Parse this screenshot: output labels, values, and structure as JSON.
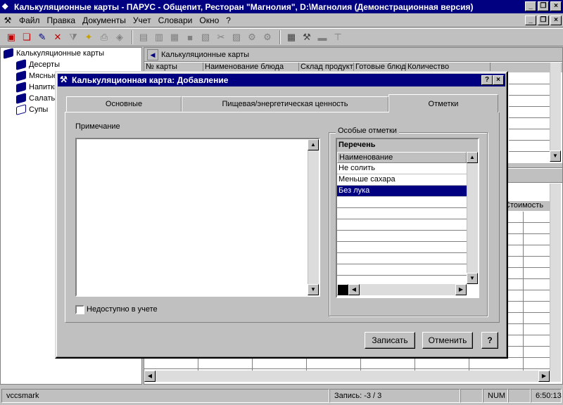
{
  "app": {
    "title": "Калькуляционные карты - ПАРУС - Общепит, Ресторан \"Магнолия\", D:\\Магнолия (Демонстрационная версия)"
  },
  "menu": [
    "Файл",
    "Правка",
    "Документы",
    "Учет",
    "Словари",
    "Окно",
    "?"
  ],
  "tree": {
    "root": "Калькуляционные карты",
    "items": [
      "Десерты",
      "Мясные",
      "Напитки",
      "Салаты",
      "Супы"
    ]
  },
  "rightpane": {
    "header": "Калькуляционные карты",
    "columns": [
      "№ карты",
      "Наименование блюда",
      "Склад продукт",
      "Готовые блюд",
      "Количество"
    ],
    "lower_column": "Стоимость"
  },
  "dialog": {
    "title": "Калькуляционная карта: Добавление",
    "tabs": [
      "Основные",
      "Пищевая/энергетическая ценность",
      "Отметки"
    ],
    "note_label": "Примечание",
    "checkbox_label": "Недоступно в учете",
    "group_title": "Особые отметки",
    "list_title": "Перечень",
    "list_header": "Наименование",
    "list_items": [
      "Не солить",
      "Меньше сахара",
      "Без лука"
    ],
    "save": "Записать",
    "cancel": "Отменить",
    "help": "?"
  },
  "status": {
    "user": "vccsmark",
    "record": "Запись: -3 / 3",
    "num": "NUM",
    "time": "6:50:13"
  },
  "colors": {
    "titlebar": "#000080",
    "face": "#c0c0c0",
    "selection": "#000080"
  }
}
